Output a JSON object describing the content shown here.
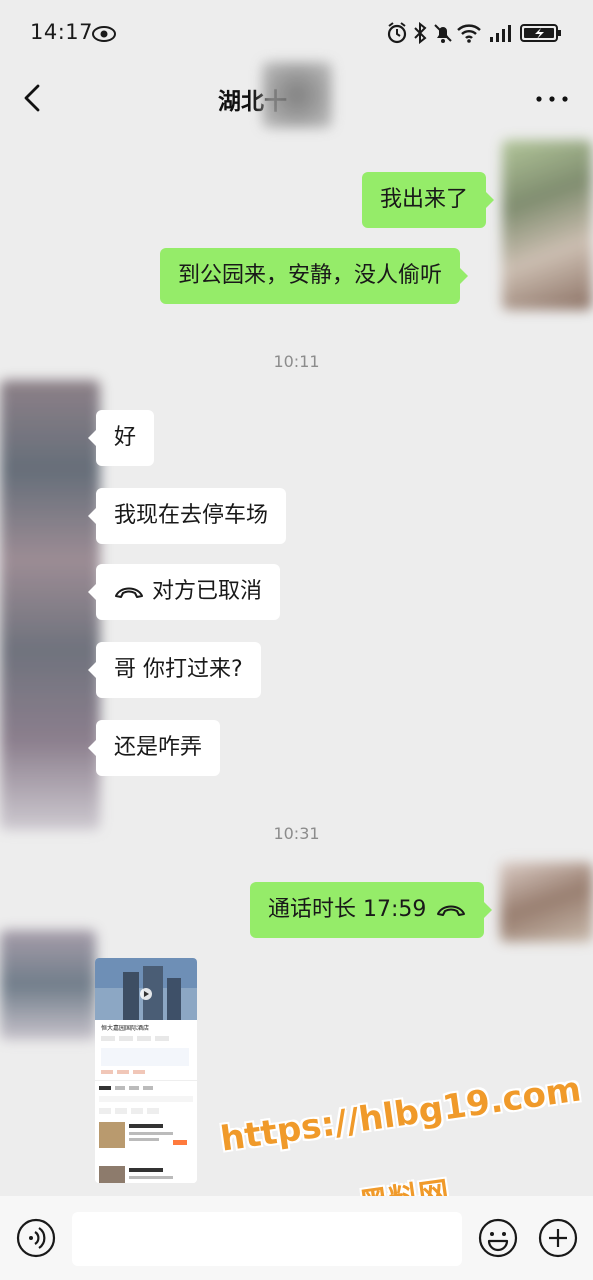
{
  "status_bar": {
    "time": "14:17",
    "icons": [
      "eye-icon",
      "alarm-icon",
      "bluetooth-icon",
      "mute-icon",
      "wifi-icon",
      "signal-icon",
      "battery-charging-icon"
    ]
  },
  "header": {
    "title": "湖北十",
    "back_icon": "chevron-left-icon",
    "more_icon": "more-dots-icon"
  },
  "messages": [
    {
      "direction": "out",
      "text": "我出来了"
    },
    {
      "direction": "out",
      "text": "到公园来，安静，没人偷听"
    },
    {
      "type": "timestamp",
      "text": "10:11"
    },
    {
      "direction": "in",
      "text": "好"
    },
    {
      "direction": "in",
      "text": "我现在去停车场"
    },
    {
      "direction": "in",
      "text": "对方已取消",
      "icon": "phone-hangup-icon"
    },
    {
      "direction": "in",
      "text": "哥 你打过来?"
    },
    {
      "direction": "in",
      "text": "还是咋弄"
    },
    {
      "type": "timestamp",
      "text": "10:31"
    },
    {
      "direction": "out",
      "text": "通话时长 17:59",
      "icon": "phone-hangup-icon"
    },
    {
      "direction": "in",
      "type": "image",
      "caption": "恒大嘉园国际酒店"
    }
  ],
  "input_bar": {
    "placeholder": "",
    "voice_icon": "voice-icon",
    "emoji_icon": "emoji-icon",
    "plus_icon": "plus-icon"
  },
  "watermark": {
    "url": "https://hlbg19.com",
    "name": "黑料网",
    "color": "#f09a2a"
  },
  "colors": {
    "outgoing_bubble": "#95ec69",
    "incoming_bubble": "#ffffff",
    "background": "#ededed"
  }
}
